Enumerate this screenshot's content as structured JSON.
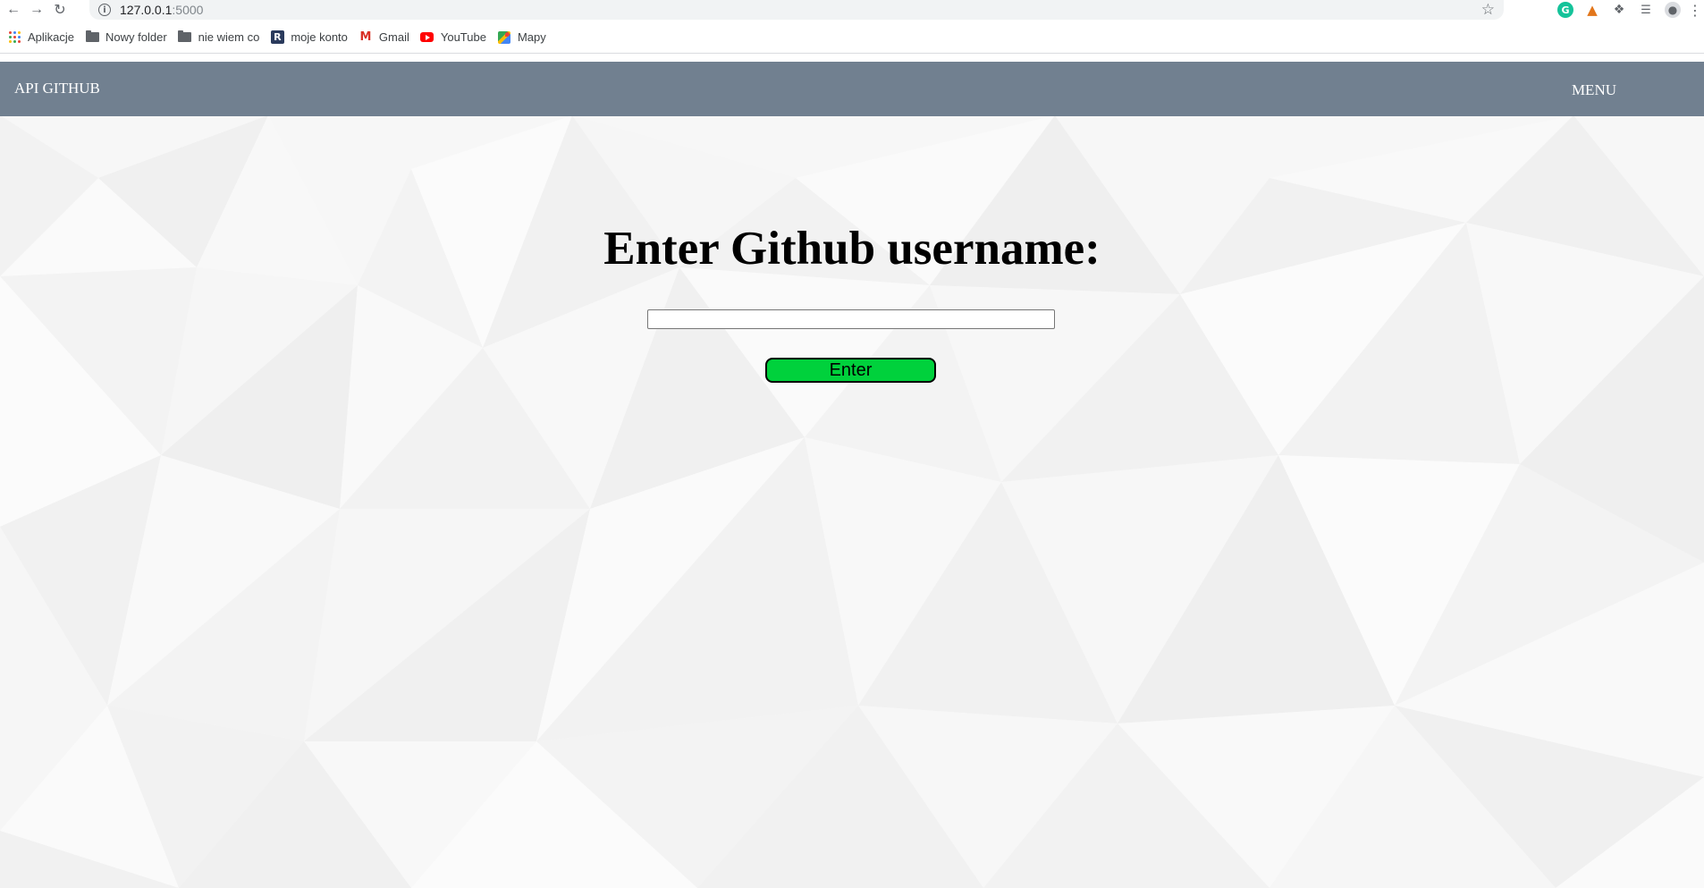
{
  "browser": {
    "url_host": "127.0.0.1",
    "url_port": ":5000",
    "bookmarks": [
      {
        "label": "Aplikacje",
        "icon": "apps-grid-icon"
      },
      {
        "label": "Nowy folder",
        "icon": "folder-icon"
      },
      {
        "label": "nie wiem co",
        "icon": "folder-icon"
      },
      {
        "label": "moje konto",
        "icon": "r-icon"
      },
      {
        "label": "Gmail",
        "icon": "gmail-icon"
      },
      {
        "label": "YouTube",
        "icon": "youtube-icon"
      },
      {
        "label": "Mapy",
        "icon": "maps-icon"
      }
    ]
  },
  "navbar": {
    "brand": "API GITHUB",
    "menu": "MENU",
    "background": "#718090"
  },
  "main": {
    "heading": "Enter Github username:",
    "username_value": "",
    "button_label": "Enter",
    "button_color": "#00d13c"
  }
}
